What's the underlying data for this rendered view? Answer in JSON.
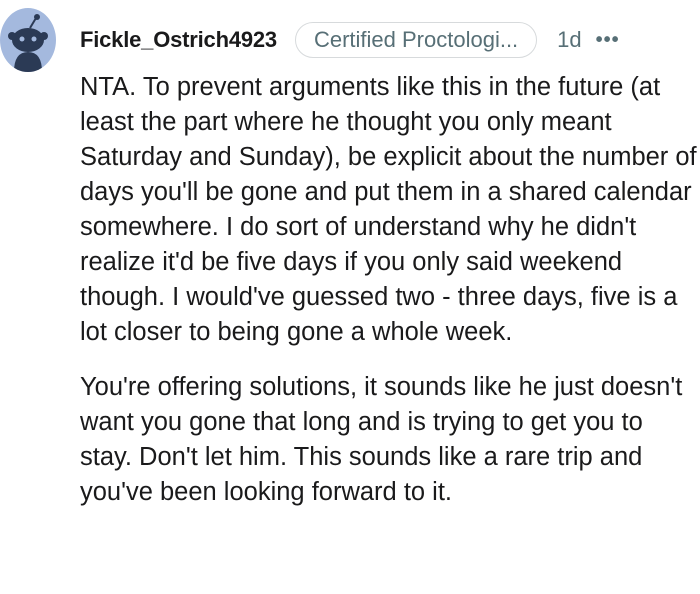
{
  "comment": {
    "username": "Fickle_Ostrich4923",
    "flair": "Certified Proctologi...",
    "age": "1d",
    "more_glyph": "•••",
    "avatar_icon": "reddit-snoo-avatar-icon",
    "paragraphs": [
      "NTA. To prevent arguments like this in the future (at least the part where he thought you only meant Saturday and Sunday), be explicit about the number of days you'll be gone and put them in a shared calendar somewhere. I do sort of understand why he didn't realize it'd be five days if you only said weekend though. I would've guessed two - three days, five is a lot closer to being gone a whole week.",
      "You're offering solutions, it sounds like he just doesn't want you gone that long and is trying to get you to stay. Don't let him. This sounds like a rare trip and you've been looking forward to it."
    ]
  },
  "colors": {
    "avatar_bg": "#a4b9de",
    "meta_text": "#576f76",
    "body_text": "#1a1a1b"
  }
}
